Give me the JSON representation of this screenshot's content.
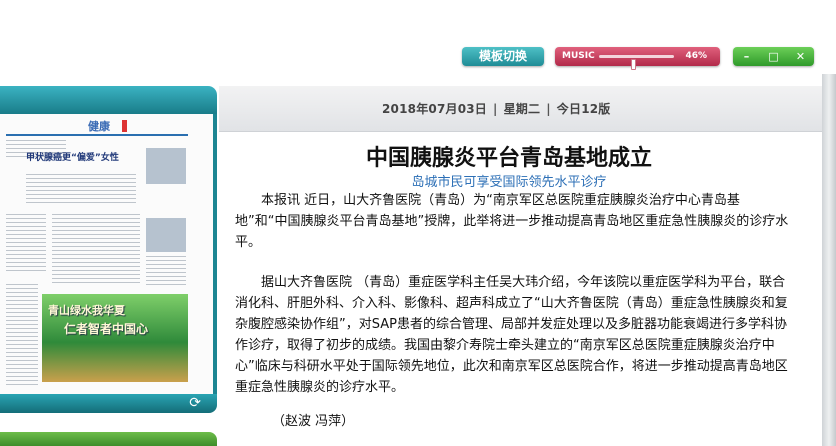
{
  "toolbar": {
    "template_switch": "模板切换",
    "music_label": "MUSIC",
    "music_volume": "46%",
    "music_volume_fraction": 0.46,
    "minimize": "–",
    "maximize": "□",
    "close": "✕"
  },
  "colors": {
    "teal": "#1f8c96",
    "pink": "#b22a4a",
    "green": "#2f9a2a",
    "subhead_blue": "#2c6fb6"
  },
  "thumbnail": {
    "section": "健康",
    "headline": "甲状腺癌更“偏爱”女性",
    "image_line1": "青山绿水我华夏",
    "image_line2": "仁者智者中国心",
    "refresh_icon": "refresh-icon"
  },
  "article": {
    "date": "2018年07月03日",
    "weekday": "星期二",
    "edition": "今日12版",
    "headline": "中国胰腺炎平台青岛基地成立",
    "subhead": "岛城市民可享受国际领先水平诊疗",
    "paragraphs": [
      "本报讯 近日，山大齐鲁医院（青岛）为“南京军区总医院重症胰腺炎治疗中心青岛基地”和“中国胰腺炎平台青岛基地”授牌，此举将进一步推动提高青岛地区重症急性胰腺炎的诊疗水平。",
      "据山大齐鲁医院 （青岛）重症医学科主任吴大玮介绍，今年该院以重症医学科为平台，联合消化科、肝胆外科、介入科、影像科、超声科成立了“山大齐鲁医院（青岛）重症急性胰腺炎和复杂腹腔感染协作组”，对SAP患者的综合管理、局部并发症处理以及多脏器功能衰竭进行多学科协作诊疗，取得了初步的成绩。我国由黎介寿院士牵头建立的“南京军区总医院重症胰腺炎治疗中心”临床与科研水平处于国际领先地位，此次和南京军区总医院合作，将进一步推动提高青岛地区重症急性胰腺炎的诊疗水平。"
    ],
    "byline": "（赵波 冯萍）"
  }
}
